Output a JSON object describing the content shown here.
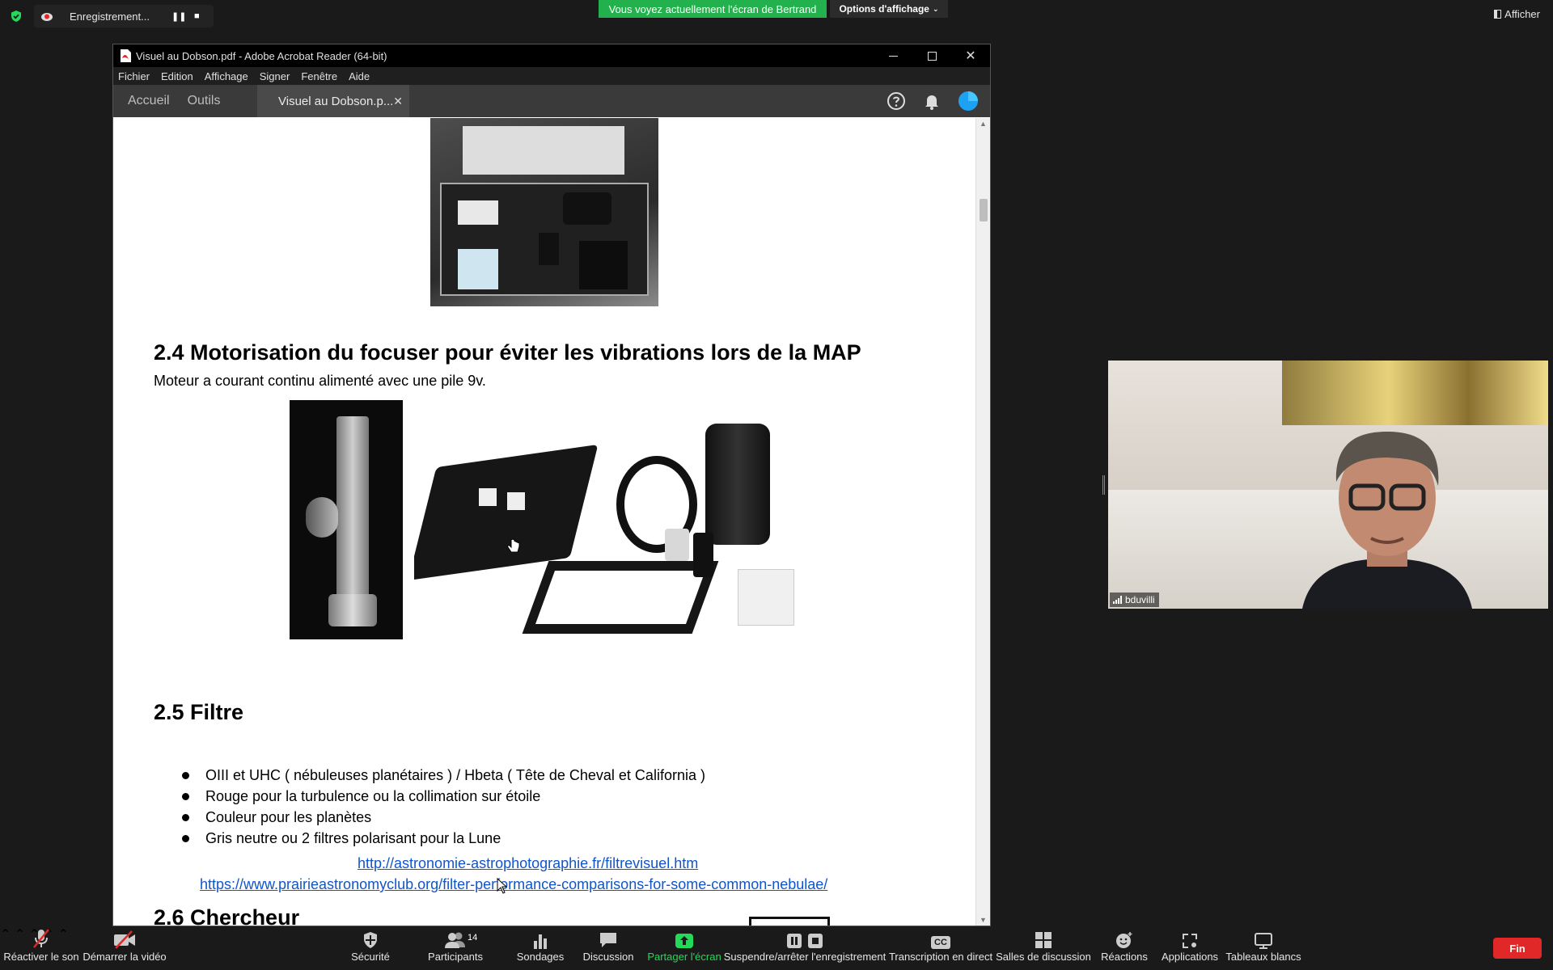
{
  "zoom_top": {
    "recording_label": "Enregistrement...",
    "share_banner": "Vous voyez actuellement l'écran de Bertrand",
    "view_options": "Options d'affichage",
    "afficher": "Afficher"
  },
  "acrobat": {
    "window_title": "Visuel au Dobson.pdf - Adobe Acrobat Reader (64-bit)",
    "menu": [
      "Fichier",
      "Edition",
      "Affichage",
      "Signer",
      "Fenêtre",
      "Aide"
    ],
    "tabs": {
      "home": "Accueil",
      "tools": "Outils",
      "document": "Visuel au Dobson.p..."
    }
  },
  "pdf": {
    "section_24": {
      "heading": "2.4 Motorisation du focuser pour éviter les vibrations lors de la MAP",
      "text": "Moteur a courant continu alimenté avec une pile 9v."
    },
    "section_25": {
      "heading": "2.5 Filtre",
      "bullets": [
        "OIII  et UHC ( nébuleuses planétaires ) / Hbeta ( Tête de Cheval et California )",
        "Rouge pour la turbulence ou la collimation sur étoile",
        "Couleur pour les planètes",
        "Gris neutre ou 2 filtres polarisant pour la Lune"
      ],
      "links": [
        "http://astronomie-astrophotographie.fr/filtrevisuel.htm",
        "https://www.prairieastronomyclub.org/filter-performance-comparisons-for-some-common-nebulae/"
      ]
    },
    "section_26": {
      "heading": "2.6 Chercheur"
    }
  },
  "webcam": {
    "participant_name": "bduvilli"
  },
  "zoom_bottom": {
    "unmute": "Réactiver le son",
    "start_video": "Démarrer la vidéo",
    "security": "Sécurité",
    "participants": "Participants",
    "participants_count": "14",
    "polls": "Sondages",
    "chat": "Discussion",
    "share_screen": "Partager l'écran",
    "pause_recording": "Suspendre/arrêter l'enregistrement",
    "live_transcript": "Transcription en direct",
    "breakout_rooms": "Salles de discussion",
    "reactions": "Réactions",
    "apps": "Applications",
    "whiteboards": "Tableaux blancs",
    "cc_label": "CC",
    "end": "Fin"
  },
  "colors": {
    "share_green": "#22b14c",
    "end_red": "#e02828",
    "link_blue": "#1155cc",
    "shield_green": "#23d959"
  }
}
